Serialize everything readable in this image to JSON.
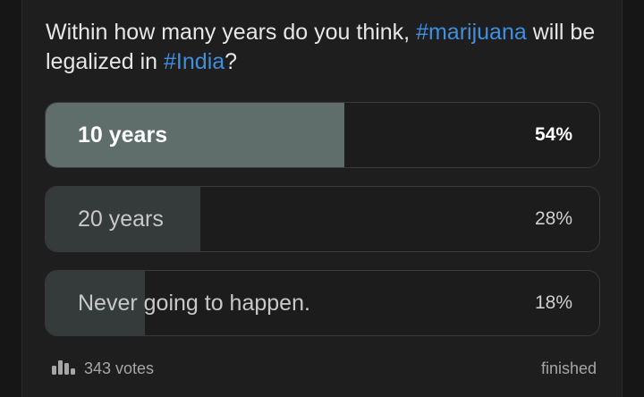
{
  "poll": {
    "question_parts": [
      {
        "text": "Within how many years do you think, ",
        "type": "text"
      },
      {
        "text": "#marijuana",
        "type": "hashtag"
      },
      {
        "text": " will be legalized in ",
        "type": "text"
      },
      {
        "text": "#India",
        "type": "hashtag"
      },
      {
        "text": "?",
        "type": "text"
      }
    ],
    "options": [
      {
        "label": "10 years",
        "percent_label": "54%",
        "fraction": 0.54,
        "leading": true
      },
      {
        "label": "20 years",
        "percent_label": "28%",
        "fraction": 0.28,
        "leading": false
      },
      {
        "label": "Never going to happen.",
        "percent_label": "18%",
        "fraction": 0.18,
        "leading": false
      }
    ],
    "votes_label": "343 votes",
    "status": "finished"
  },
  "icons": {
    "votes": "bar-chart-icon"
  },
  "colors": {
    "background": "#1e1e1e",
    "hashtag": "#3f8fe0",
    "leading_fill": "#5f6d6b",
    "other_fill": "#353b3a"
  }
}
